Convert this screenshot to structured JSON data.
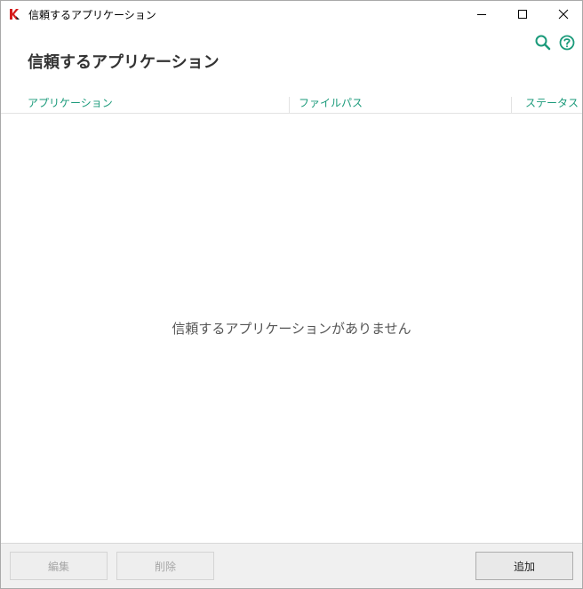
{
  "window": {
    "title": "信頼するアプリケーション",
    "controls": [
      "minimize",
      "maximize",
      "close"
    ]
  },
  "header": {
    "title": "信頼するアプリケーション",
    "icons": [
      "search-icon",
      "help-icon"
    ],
    "accent_color": "#1a9a7a"
  },
  "table": {
    "columns": [
      "アプリケーション",
      "ファイルパス",
      "ステータス"
    ],
    "rows": [],
    "empty_message": "信頼するアプリケーションがありません"
  },
  "footer": {
    "edit_label": "編集",
    "delete_label": "削除",
    "add_label": "追加",
    "edit_enabled": false,
    "delete_enabled": false
  }
}
